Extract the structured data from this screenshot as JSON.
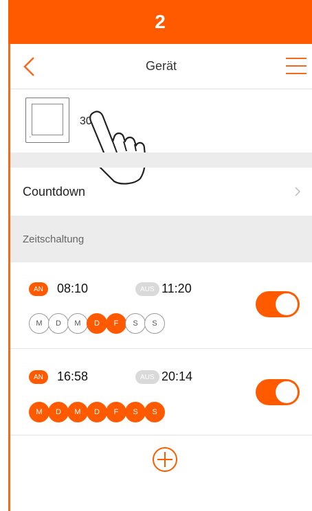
{
  "step": "2",
  "nav": {
    "title": "Gerät",
    "back_icon": "chevron-left-icon",
    "menu_icon": "hamburger-menu-icon"
  },
  "device": {
    "name": "301",
    "icon": "device-switch-icon"
  },
  "countdown": {
    "label": "Countdown"
  },
  "schedule": {
    "section_label": "Zeitschaltung",
    "timers": [
      {
        "on_label": "AN",
        "on_time": "08:10",
        "off_label": "AUS",
        "off_time": "11:20",
        "enabled": true,
        "days": [
          {
            "label": "M",
            "active": false
          },
          {
            "label": "D",
            "active": false
          },
          {
            "label": "M",
            "active": false
          },
          {
            "label": "D",
            "active": true
          },
          {
            "label": "F",
            "active": true
          },
          {
            "label": "S",
            "active": false
          },
          {
            "label": "S",
            "active": false
          }
        ]
      },
      {
        "on_label": "AN",
        "on_time": "16:58",
        "off_label": "AUS",
        "off_time": "20:14",
        "enabled": true,
        "days": [
          {
            "label": "M",
            "active": true
          },
          {
            "label": "D",
            "active": true
          },
          {
            "label": "M",
            "active": true
          },
          {
            "label": "D",
            "active": true
          },
          {
            "label": "F",
            "active": true
          },
          {
            "label": "S",
            "active": true
          },
          {
            "label": "S",
            "active": true
          }
        ]
      }
    ]
  },
  "colors": {
    "accent": "#ff5a00",
    "inactive": "#d9d9d9",
    "section_bg": "#ececec"
  }
}
